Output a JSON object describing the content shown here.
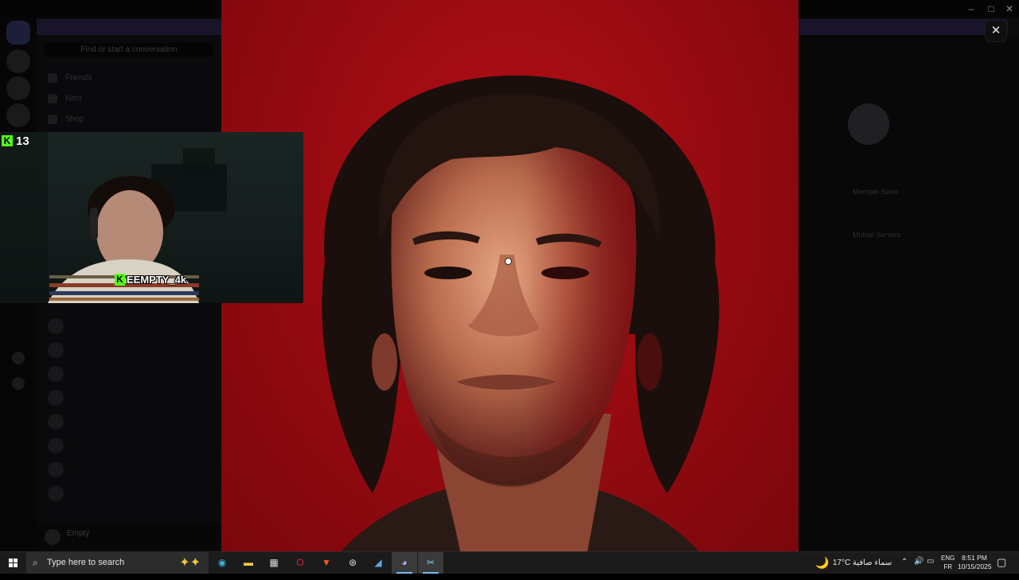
{
  "background_app": {
    "search_placeholder": "Find or start a conversation",
    "nav": [
      "Friends",
      "Nitro",
      "Shop"
    ],
    "dm_rows": [
      "",
      "",
      "",
      "",
      "",
      "",
      "",
      ""
    ],
    "user": {
      "name": "Empty"
    },
    "right_panel": {
      "lines": [
        "Member Since",
        "Mutual Servers"
      ]
    }
  },
  "viewer": {
    "close_icon": "close-icon"
  },
  "webcam": {
    "platform_icon": "kick-logo-icon",
    "viewer_count": "13",
    "handle": "EEMPTY_4k"
  },
  "taskbar": {
    "search_placeholder": "Type here to search",
    "apps": [
      "edge-icon",
      "file-explorer-icon",
      "store-icon",
      "opera-icon",
      "brave-icon",
      "steam-icon",
      "paint-icon",
      "discord-icon",
      "snipping-tool-icon"
    ],
    "weather": {
      "temp": "17°C",
      "desc": "سماء صافية"
    },
    "lang": {
      "line1": "ENG",
      "line2": "FR"
    },
    "time": "8:51 PM",
    "date": "10/15/2025"
  }
}
